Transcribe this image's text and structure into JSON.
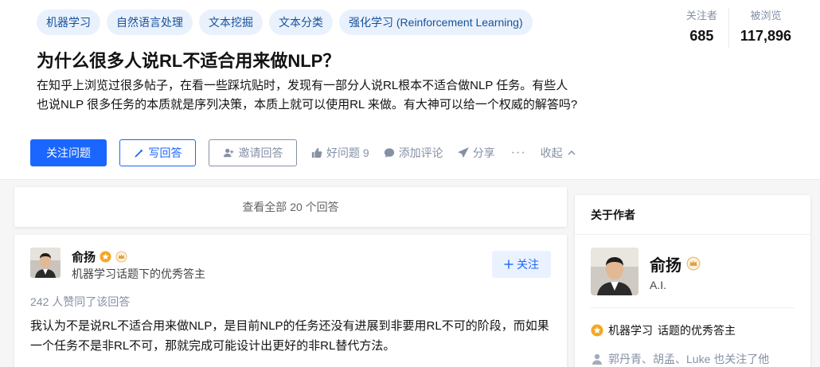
{
  "topics": [
    "机器学习",
    "自然语言处理",
    "文本挖掘",
    "文本分类",
    "强化学习 (Reinforcement Learning)"
  ],
  "stats": {
    "followers_label": "关注者",
    "followers_value": "685",
    "views_label": "被浏览",
    "views_value": "117,896"
  },
  "question": {
    "title": "为什么很多人说RL不适合用来做NLP？",
    "detail": "在知乎上浏览过很多帖子，在看一些踩坑贴时，发现有一部分人说RL根本不适合做NLP 任务。有些人也说NLP 很多任务的本质就是序列决策，本质上就可以使用RL 来做。有大神可以给一个权威的解答吗?"
  },
  "actions": {
    "follow_question": "关注问题",
    "write_answer": "写回答",
    "invite_answer": "邀请回答",
    "good_question": "好问题 9",
    "add_comment": "添加评论",
    "share": "分享",
    "more": "···",
    "collapse": "收起"
  },
  "answers": {
    "view_all": "查看全部 20 个回答"
  },
  "answer": {
    "author_name": "俞扬",
    "author_desc": "机器学习话题下的优秀答主",
    "follow_label": "关注",
    "upvotes": "242 人赞同了该回答",
    "content": "我认为不是说RL不适合用来做NLP，是目前NLP的任务还没有进展到非要用RL不可的阶段，而如果一个任务不是非RL不可，那就完成可能设计出更好的非RL替代方法。"
  },
  "sidebar": {
    "title": "关于作者",
    "author_name": "俞扬",
    "headline": "A.I.",
    "honor_topic": "机器学习",
    "honor_suffix": "话题的优秀答主",
    "mutual_follow": "郭丹青、胡孟、Luke 也关注了他"
  },
  "colors": {
    "brand_blue": "#1a66ff",
    "topic_bg": "#e9f1fd",
    "topic_text": "#175199",
    "muted": "#8590a6",
    "badge_orange": "#f6a623"
  }
}
